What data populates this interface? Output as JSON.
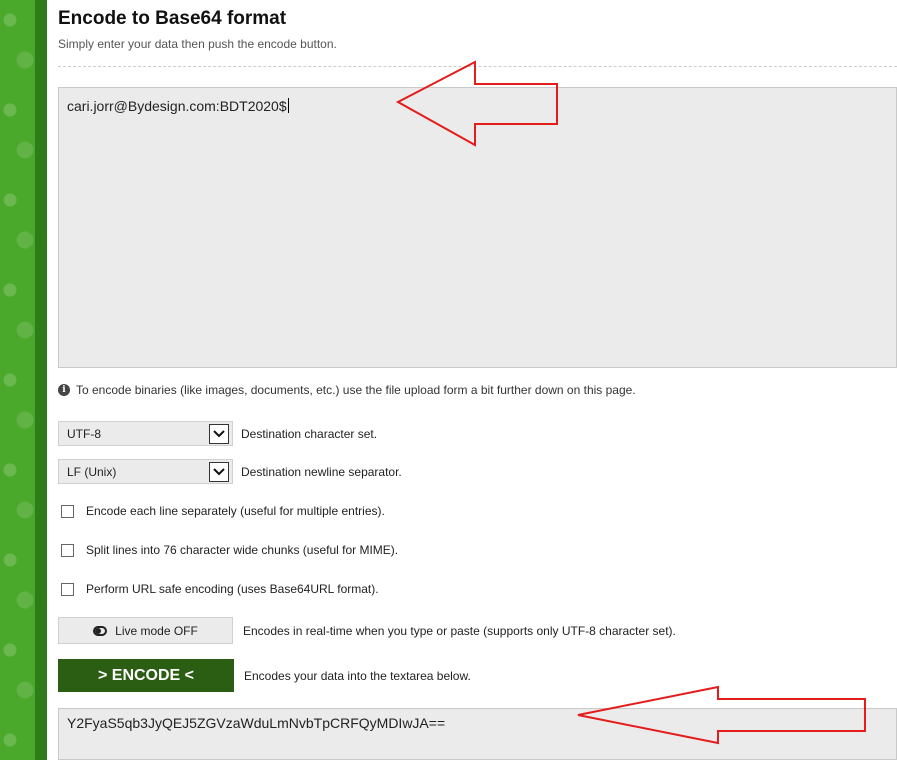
{
  "header": {
    "title": "Encode to Base64 format",
    "subtitle": "Simply enter your data then push the encode button."
  },
  "input": {
    "value": "cari.jorr@Bydesign.com:BDT2020$"
  },
  "hint": {
    "icon": "info-icon",
    "text": "To encode binaries (like images, documents, etc.) use the file upload form a bit further down on this page."
  },
  "options": {
    "charset": {
      "value": "UTF-8",
      "label": "Destination character set."
    },
    "newline": {
      "value": "LF (Unix)",
      "label": "Destination newline separator."
    },
    "each_line": {
      "checked": false,
      "label": "Encode each line separately (useful for multiple entries)."
    },
    "split_lines": {
      "checked": false,
      "label": "Split lines into 76 character wide chunks (useful for MIME)."
    },
    "url_safe": {
      "checked": false,
      "label": "Perform URL safe encoding (uses Base64URL format)."
    }
  },
  "live_mode": {
    "button_label": "Live mode OFF",
    "description": "Encodes in real-time when you type or paste (supports only UTF-8 character set)."
  },
  "encode": {
    "button_label": "> ENCODE <",
    "description": "Encodes your data into the textarea below."
  },
  "output": {
    "value": "Y2FyaS5qb3JyQEJ5ZGVzaWduLmNvbTpCRFQyMDIwJA=="
  },
  "colors": {
    "accent_green": "#2b5d12",
    "annotation_red": "#e41c1c"
  }
}
